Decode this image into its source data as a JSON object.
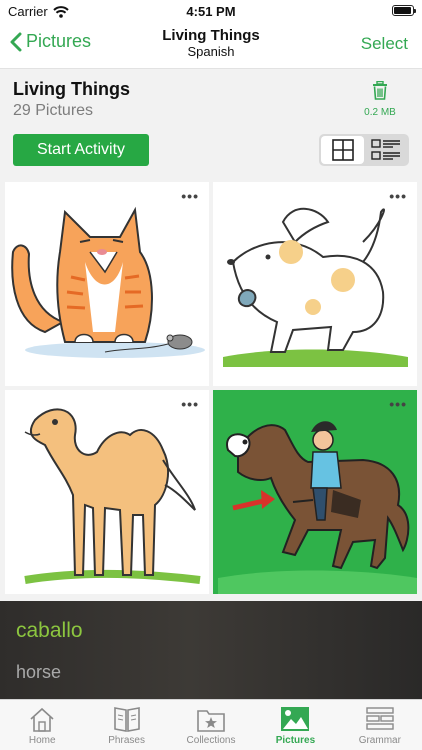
{
  "status_bar": {
    "carrier": "Carrier",
    "time": "4:51 PM"
  },
  "nav": {
    "back_label": "Pictures",
    "title": "Living Things",
    "subtitle": "Spanish",
    "select_label": "Select"
  },
  "header": {
    "title": "Living Things",
    "count": "29 Pictures",
    "size": "0.2 MB",
    "start_label": "Start Activity"
  },
  "cards": [
    {
      "name": "cat",
      "more": "•••"
    },
    {
      "name": "dog",
      "more": "•••"
    },
    {
      "name": "camel",
      "more": "•••"
    },
    {
      "name": "horse",
      "more": "•••"
    }
  ],
  "overlay": {
    "word": "caballo",
    "translation": "horse"
  },
  "tabs": [
    {
      "label": "Home",
      "icon": "home-icon",
      "active": false
    },
    {
      "label": "Phrases",
      "icon": "book-icon",
      "active": false
    },
    {
      "label": "Collections",
      "icon": "folder-star-icon",
      "active": false
    },
    {
      "label": "Pictures",
      "icon": "picture-icon",
      "active": true
    },
    {
      "label": "Grammar",
      "icon": "grammar-icon",
      "active": false
    }
  ],
  "colors": {
    "accent": "#34a853",
    "button": "#27a844",
    "word": "#8cc63f",
    "horse_bg": "#2fb14a"
  }
}
